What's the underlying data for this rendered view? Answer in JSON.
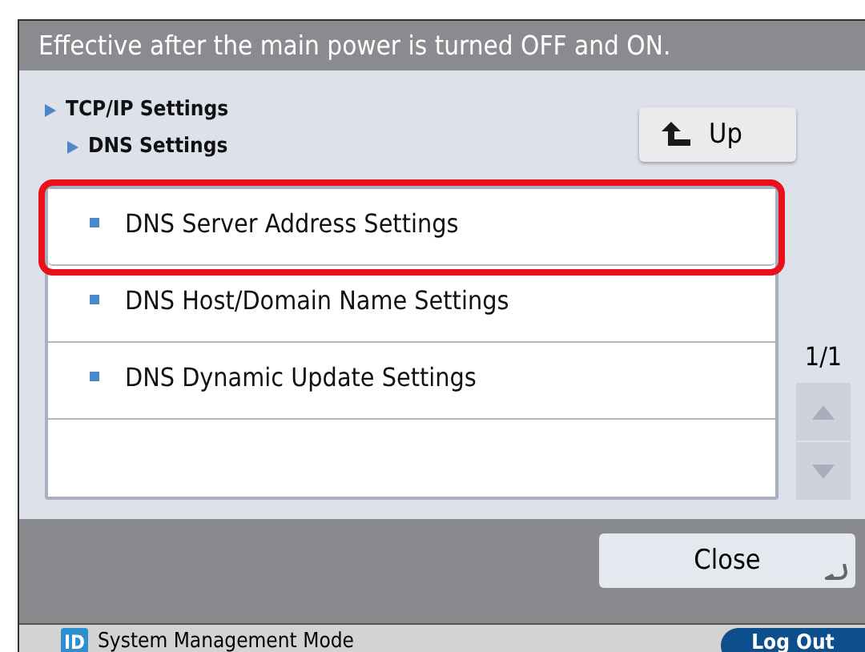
{
  "header": {
    "message": "Effective after the main power is turned OFF and ON."
  },
  "breadcrumb": [
    {
      "label": "TCP/IP Settings"
    },
    {
      "label": "DNS Settings"
    }
  ],
  "up_button": {
    "label": "Up"
  },
  "items": [
    {
      "label": "DNS Server Address Settings",
      "highlighted": true
    },
    {
      "label": "DNS Host/Domain Name Settings",
      "highlighted": false
    },
    {
      "label": "DNS Dynamic Update Settings",
      "highlighted": false
    }
  ],
  "pager": {
    "page": "1/1",
    "up_disabled": true,
    "down_disabled": true
  },
  "close_button": {
    "label": "Close"
  },
  "status_bar": {
    "badge": "ID",
    "mode": "System Management Mode",
    "logout": "Log Out"
  }
}
